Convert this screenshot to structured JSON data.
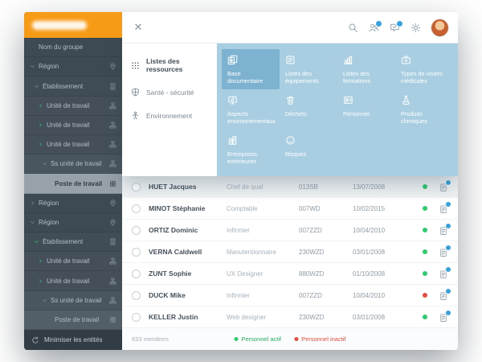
{
  "window": {
    "close_label": "✕"
  },
  "sidebar": {
    "items": [
      {
        "label": "Nom du groupe",
        "depth": 0,
        "icon": null,
        "chevron": null
      },
      {
        "label": "Région",
        "depth": 0,
        "icon": "pin-icon",
        "chevron": "down"
      },
      {
        "label": "Établissement",
        "depth": 1,
        "icon": "building-icon",
        "chevron": "down"
      },
      {
        "label": "Unité de travail",
        "depth": 2,
        "icon": "orgchart-icon",
        "chevron": "right",
        "chevron_green": true
      },
      {
        "label": "Unité de travail",
        "depth": 2,
        "icon": "orgchart-icon",
        "chevron": "right",
        "chevron_green": true
      },
      {
        "label": "Unité de travail",
        "depth": 2,
        "icon": "orgchart-icon",
        "chevron": "right",
        "chevron_green": true
      },
      {
        "label": "Ss unité de travail",
        "depth": 3,
        "icon": "orgchart-icon",
        "chevron": "down"
      },
      {
        "label": "Poste de travail",
        "depth": 4,
        "icon": "workstation-icon",
        "chevron": null,
        "selected": true
      },
      {
        "label": "Région",
        "depth": 0,
        "icon": "pin-icon",
        "chevron": "right"
      },
      {
        "label": "Région",
        "depth": 0,
        "icon": "pin-icon",
        "chevron": "down"
      },
      {
        "label": "Établissement",
        "depth": 1,
        "icon": "building-icon",
        "chevron": "down",
        "chevron_green": true
      },
      {
        "label": "Unité de travail",
        "depth": 2,
        "icon": "orgchart-icon",
        "chevron": "right",
        "chevron_green": true
      },
      {
        "label": "Unité de travail",
        "depth": 2,
        "icon": "orgchart-icon",
        "chevron": "right",
        "chevron_green": true
      },
      {
        "label": "Ss unité de travail",
        "depth": 3,
        "icon": "orgchart-icon",
        "chevron": "down"
      },
      {
        "label": "Poste de travail",
        "depth": 4,
        "icon": "workstation-icon",
        "chevron": null
      }
    ],
    "footer": {
      "label": "Minimiser les entités",
      "icon": "minimize-icon"
    }
  },
  "topbar": {
    "icons": [
      {
        "name": "search-icon",
        "badge": false
      },
      {
        "name": "users-icon",
        "badge": true
      },
      {
        "name": "messages-icon",
        "badge": true
      },
      {
        "name": "gear-icon",
        "badge": false
      }
    ]
  },
  "menu": {
    "items": [
      {
        "label": "Listes des ressources",
        "icon": "grid-icon",
        "active": true
      },
      {
        "label": "Santé - sécurité",
        "icon": "shield-icon",
        "active": false
      },
      {
        "label": "Environnement",
        "icon": "person-icon",
        "active": false
      }
    ],
    "tiles": [
      {
        "label": "Base documentaire",
        "icon": "documents-icon",
        "active": true
      },
      {
        "label": "Listes des équipements",
        "icon": "equipment-icon",
        "active": false
      },
      {
        "label": "Listes des formations",
        "icon": "formations-icon",
        "active": false
      },
      {
        "label": "Types de visites médicales",
        "icon": "medical-icon",
        "active": false
      },
      {
        "label": "Aspects environnementaux",
        "icon": "environment-icon",
        "active": false
      },
      {
        "label": "Déchets",
        "icon": "waste-icon",
        "active": false
      },
      {
        "label": "Personnel",
        "icon": "personnel-icon",
        "active": false
      },
      {
        "label": "Produits chimiques",
        "icon": "chemicals-icon",
        "active": false
      },
      {
        "label": "Entreprises extérieures",
        "icon": "company-icon",
        "active": false
      },
      {
        "label": "Risques",
        "icon": "risks-icon",
        "active": false
      }
    ]
  },
  "table": {
    "rows": [
      {
        "name": "HUET Jacques",
        "role": "Chef de qual",
        "code": "013SB",
        "date": "13/07/2008",
        "status": "active",
        "highlight": true
      },
      {
        "name": "MINOT Stéphanie",
        "role": "Comptable",
        "code": "007WD",
        "date": "10/02/2015",
        "status": "active"
      },
      {
        "name": "ORTIZ Dominic",
        "role": "Infirmier",
        "code": "007ZZD",
        "date": "10/04/2010",
        "status": "active"
      },
      {
        "name": "VERNA Caldwell",
        "role": "Manutentionnaire",
        "code": "230WZD",
        "date": "03/01/2008",
        "status": "active"
      },
      {
        "name": "ZUNT Sophie",
        "role": "UX Designer",
        "code": "880WZD",
        "date": "01/10/2008",
        "status": "active"
      },
      {
        "name": "DUCK Mike",
        "role": "Infirmier",
        "code": "007ZZD",
        "date": "10/04/2010",
        "status": "inactive"
      },
      {
        "name": "KELLER Justin",
        "role": "Web designer",
        "code": "230WZD",
        "date": "03/01/2008",
        "status": "active"
      }
    ]
  },
  "footer": {
    "count": "833 membres",
    "legend": [
      {
        "label": "Personnel actif",
        "color": "#27ae60"
      },
      {
        "label": "Personnel inactif",
        "color": "#e74c3c"
      }
    ]
  },
  "colors": {
    "accent_orange": "#f79b17",
    "sidebar_dark": "#3e4a53",
    "menu_blue": "#a9cee1",
    "active_tile_blue": "#7db3d1",
    "badge_blue": "#36a3e0",
    "active_green": "#2ecc71",
    "inactive_red": "#e74c3c"
  }
}
